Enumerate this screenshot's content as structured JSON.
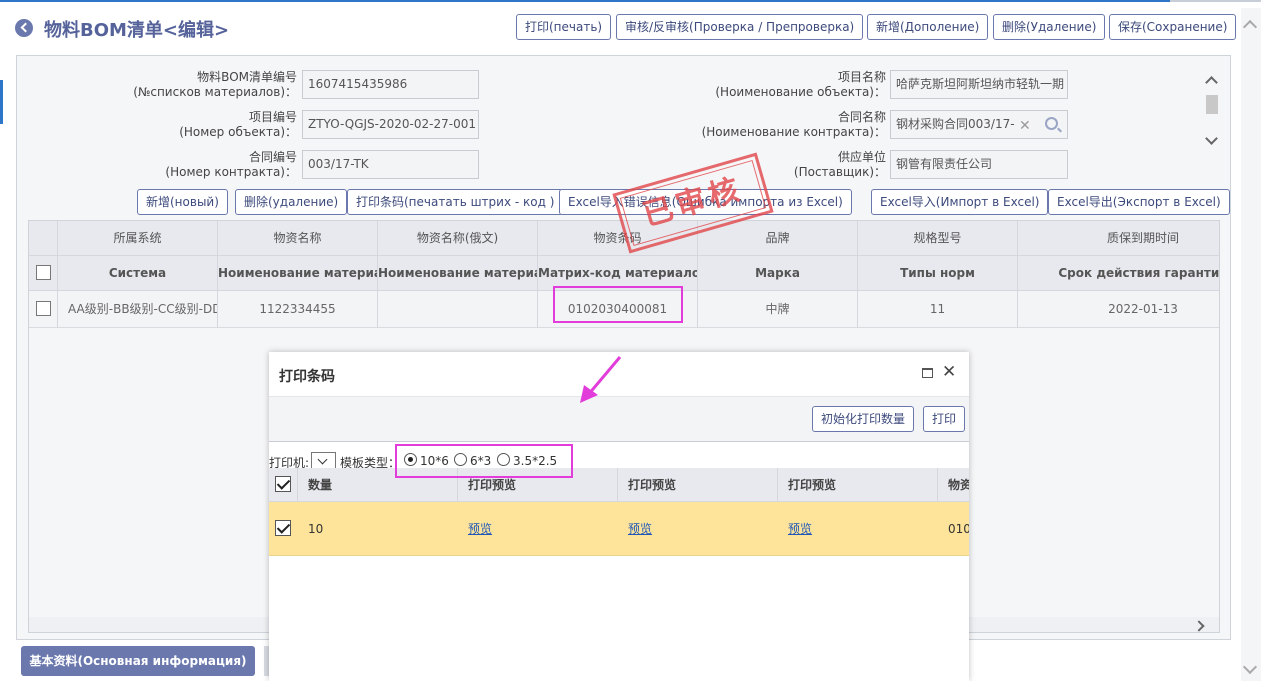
{
  "header": {
    "title": "物料BOM清单<编辑>",
    "buttons": {
      "print": "打印(печать)",
      "audit": "审核/反审核(Проверка / Препроверка)",
      "add": "新增(Дополение)",
      "delete": "删除(Удаление)",
      "save": "保存(Сохранение)"
    }
  },
  "form": {
    "bom_no": {
      "label1": "物料BOM清单编号",
      "label2": "(№списков материалов)：",
      "value": "1607415435986"
    },
    "project_no": {
      "label1": "项目编号",
      "label2": "(Номер объекта)：",
      "value": "ZTYO-QGJS-2020-02-27-001"
    },
    "contract_no": {
      "label1": "合同编号",
      "label2": "(Номер контракта)：",
      "value": "003/17-TK"
    },
    "project_name": {
      "label1": "项目名称",
      "label2": "(Ноименование объекта)：",
      "value": "哈萨克斯坦阿斯坦纳市轻轨一期"
    },
    "contract_name": {
      "label1": "合同名称",
      "label2": "(Ноименование контракта)：",
      "value": "钢材采购合同003/17-"
    },
    "supplier": {
      "label1": "供应单位",
      "label2": "(Поставщик)：",
      "value": "钢管有限责任公司"
    }
  },
  "grid_toolbar": {
    "add": "新增(новый)",
    "delete": "删除(удаление)",
    "print_barcode": "打印条码(печатать штрих - код )",
    "excel_import_error": "Excel导入错误信息(Ошибка импорта из Excel)",
    "excel_import": "Excel导入(Импорт в Excel)",
    "excel_export": "Excel导出(Экспорт в Excel)"
  },
  "stamp": "已审核",
  "grid": {
    "columns_cn": [
      "所属系统",
      "物资名称",
      "物资名称(俄文)",
      "物资条码",
      "品牌",
      "规格型号",
      "质保到期时间"
    ],
    "columns_ru": [
      "Система",
      "Ноименование материала",
      "Ноименование материала",
      "Матрих-код материалов",
      "Марка",
      "Типы норм",
      "Срок действия гарантии"
    ],
    "rows": [
      [
        "AA级别-BB级别-CC级别-DD级别",
        "1122334455",
        "",
        "0102030400081",
        "中牌",
        "11",
        "2022-01-13"
      ]
    ]
  },
  "bottom_tab": "基本资料(Основная информация)",
  "dialog": {
    "title": "打印条码",
    "init_qty_button": "初始化打印数量",
    "print_button": "打印",
    "printer_label": "打印机:",
    "template_label": "模板类型：",
    "templates": [
      "10*6",
      "6*3",
      "3.5*2.5"
    ],
    "selected_template": "10*6",
    "columns": [
      "数量",
      "打印预览",
      "打印预览",
      "打印预览",
      "物资"
    ],
    "row": {
      "qty": "10",
      "preview1": "预览",
      "preview2": "预览",
      "preview3": "预览",
      "code": "010"
    }
  },
  "colors": {
    "accent": "#6b78ae",
    "highlight": "#e23ddb",
    "stamp": "#e2474a",
    "selected_row": "#fde49a"
  }
}
